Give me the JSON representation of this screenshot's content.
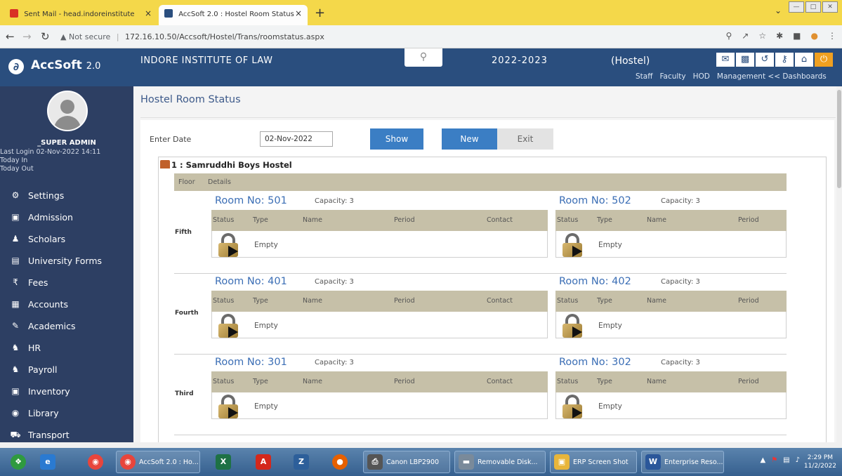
{
  "browser": {
    "tabs": [
      {
        "title": "Sent Mail - head.indoreinstitute",
        "close": "×"
      },
      {
        "title": "AccSoft 2.0 : Hostel Room Status",
        "close": "×"
      }
    ],
    "new_tab": "+",
    "url_security": "Not secure",
    "url": "172.16.10.50/Accsoft/Hostel/Trans/roomstatus.aspx"
  },
  "header": {
    "app_name": "AccSoft",
    "app_version": "2.0",
    "institute": "INDORE INSTITUTE OF LAW",
    "session": "2022-2023",
    "module": "(Hostel)",
    "links": [
      "Staff",
      "Faculty",
      "HOD",
      "Management << Dashboards"
    ]
  },
  "sidebar": {
    "user": "_SUPER ADMIN",
    "last_login": "Last Login  02-Nov-2022 14:11",
    "today_in": "Today In",
    "today_out": "Today Out",
    "items": [
      {
        "label": "Settings",
        "icon": "gear-icon"
      },
      {
        "label": "Admission",
        "icon": "id-card-icon"
      },
      {
        "label": "Scholars",
        "icon": "user-icon"
      },
      {
        "label": "University Forms",
        "icon": "form-icon"
      },
      {
        "label": "Fees",
        "icon": "rupee-icon"
      },
      {
        "label": "Accounts",
        "icon": "ledger-icon"
      },
      {
        "label": "Academics",
        "icon": "pen-icon"
      },
      {
        "label": "HR",
        "icon": "users-icon"
      },
      {
        "label": "Payroll",
        "icon": "payroll-icon"
      },
      {
        "label": "Inventory",
        "icon": "box-icon"
      },
      {
        "label": "Library",
        "icon": "book-icon"
      },
      {
        "label": "Transport",
        "icon": "bus-icon"
      }
    ]
  },
  "page": {
    "title": "Hostel Room Status",
    "date_label": "Enter Date",
    "date_value": "02-Nov-2022",
    "show_label": "Show",
    "new_label": "New",
    "exit_label": "Exit",
    "hostel_name": "1 : Samruddhi Boys Hostel",
    "col_floor": "Floor",
    "col_details": "Details",
    "room_cols": [
      "Status",
      "Type",
      "Name",
      "Period",
      "Contact"
    ],
    "floors": [
      {
        "name": "Fifth",
        "rooms": [
          {
            "no": "Room No: 501",
            "cap": "Capacity: 3",
            "status": "Empty"
          },
          {
            "no": "Room No: 502",
            "cap": "Capacity: 3",
            "status": "Empty"
          }
        ]
      },
      {
        "name": "Fourth",
        "rooms": [
          {
            "no": "Room No: 401",
            "cap": "Capacity: 3",
            "status": "Empty"
          },
          {
            "no": "Room No: 402",
            "cap": "Capacity: 3",
            "status": "Empty"
          }
        ]
      },
      {
        "name": "Third",
        "rooms": [
          {
            "no": "Room No: 301",
            "cap": "Capacity: 3",
            "status": "Empty"
          },
          {
            "no": "Room No: 302",
            "cap": "Capacity: 3",
            "status": "Empty"
          }
        ]
      }
    ]
  },
  "taskbar": {
    "items": [
      {
        "label": "AccSoft 2.0 : Ho..."
      },
      {
        "label": "Canon LBP2900"
      },
      {
        "label": "Removable Disk..."
      },
      {
        "label": "ERP Screen Shot"
      },
      {
        "label": "Enterprise Reso..."
      }
    ],
    "time": "2:29 PM",
    "date": "11/2/2022"
  }
}
